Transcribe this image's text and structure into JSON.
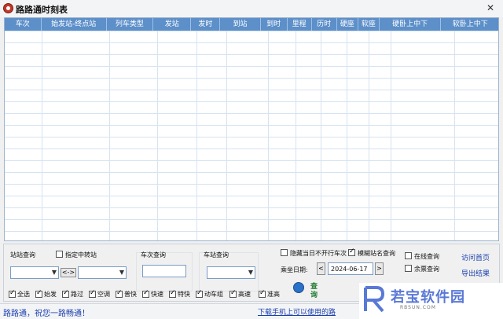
{
  "window": {
    "title": "路路通时刻表",
    "close": "✕"
  },
  "grid": {
    "columns": [
      "车次",
      "始发站-终点站",
      "列车类型",
      "发站",
      "发时",
      "到站",
      "到时",
      "里程",
      "历时",
      "硬座",
      "软座",
      "硬卧上中下",
      "软卧上中下"
    ]
  },
  "station_query": {
    "label": "站站查询",
    "transfer_label": "指定中转站",
    "swap": "<->"
  },
  "train_query": {
    "label": "车次查询"
  },
  "station_stop_query": {
    "label": "车站查询"
  },
  "options": {
    "hide_no_run": "隐藏当日不开行车次",
    "fuzzy": "模糊站名查询",
    "online": "在线查询",
    "ticket": "余票查询"
  },
  "date": {
    "label": "乘坐日期:",
    "value": "2024-06-17",
    "prev": "<",
    "next": ">"
  },
  "query_button": {
    "line1": "查",
    "line2": "询"
  },
  "links": {
    "home": "访问首页",
    "export": "导出结果"
  },
  "filters": [
    {
      "label": "全选",
      "checked": true
    },
    {
      "label": "始发",
      "checked": true
    },
    {
      "label": "路过",
      "checked": true
    },
    {
      "label": "空调",
      "checked": true
    },
    {
      "label": "普快",
      "checked": true
    },
    {
      "label": "快速",
      "checked": true
    },
    {
      "label": "特快",
      "checked": true
    },
    {
      "label": "动车组",
      "checked": true
    },
    {
      "label": "高速",
      "checked": true
    },
    {
      "label": "准高",
      "checked": true
    }
  ],
  "status": {
    "left": "路路通，祝您一路畅通！",
    "right": "下载手机上可以使用的路"
  },
  "watermark": {
    "text": "若宝软件园",
    "sub": "RBSUN.COM"
  },
  "colors": {
    "header_bg": "#5d8fc9",
    "accent": "#1b3fae",
    "grid_line": "#d6e3f1"
  }
}
